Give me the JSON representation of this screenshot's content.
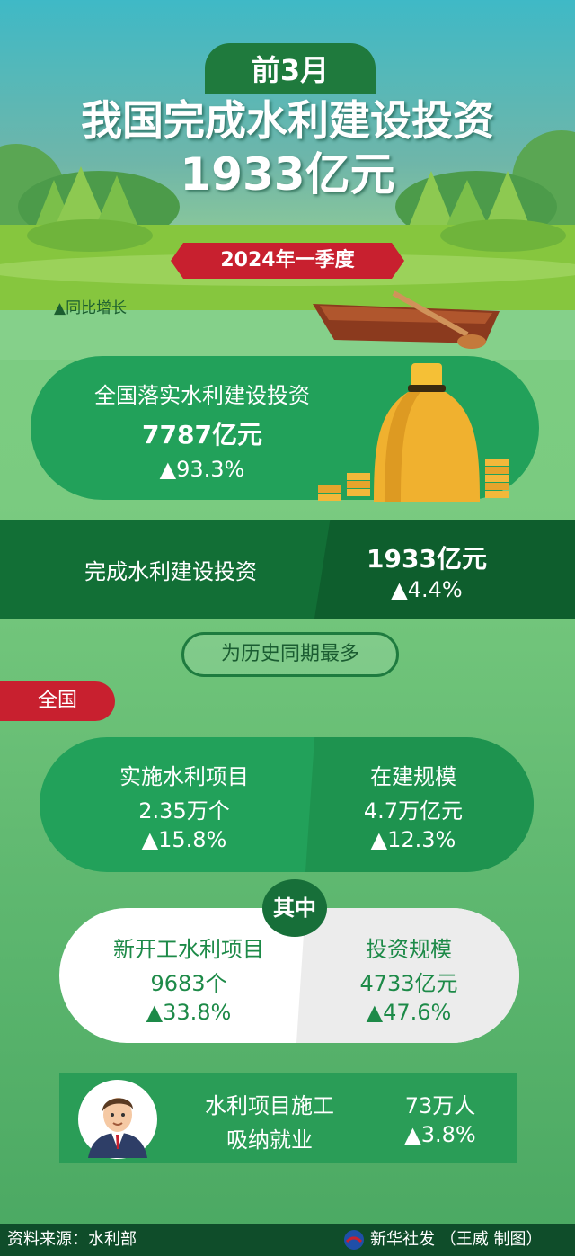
{
  "header": {
    "badge": "前3月",
    "title_line1": "我国完成水利建设投资",
    "title_line2": "1933亿元",
    "period_ribbon": "2024年一季度",
    "legend": "▲同比增长"
  },
  "national_implemented": {
    "label": "全国落实水利建设投资",
    "value": "7787亿元",
    "growth": "▲93.3%"
  },
  "completed": {
    "label": "完成水利建设投资",
    "value": "1933亿元",
    "growth": "▲4.4%"
  },
  "historic_note": "为历史同期最多",
  "section_tag": "全国",
  "projects": {
    "label": "实施水利项目",
    "value": "2.35万个",
    "growth": "▲15.8%"
  },
  "construction_scale": {
    "label": "在建规模",
    "value": "4.7万亿元",
    "growth": "▲12.3%"
  },
  "among_them": "其中",
  "new_projects": {
    "label": "新开工水利项目",
    "value": "9683个",
    "growth": "▲33.8%"
  },
  "investment_scale": {
    "label": "投资规模",
    "value": "4733亿元",
    "growth": "▲47.6%"
  },
  "employment": {
    "label_line1": "水利项目施工",
    "label_line2": "吸纳就业",
    "value": "73万人",
    "growth": "▲3.8%"
  },
  "footer": {
    "source": "资料来源：水利部",
    "credit": "新华社发 （王威 制图）"
  },
  "colors": {
    "dark_green": "#126f36",
    "card_green": "#22a15a",
    "red": "#c8202f",
    "gold": "#f2b531"
  },
  "icons": [
    "money-bag-icon",
    "coin-stack-icon",
    "boat-icon",
    "tree-icon",
    "worker-avatar-icon",
    "xinhua-logo-icon"
  ]
}
